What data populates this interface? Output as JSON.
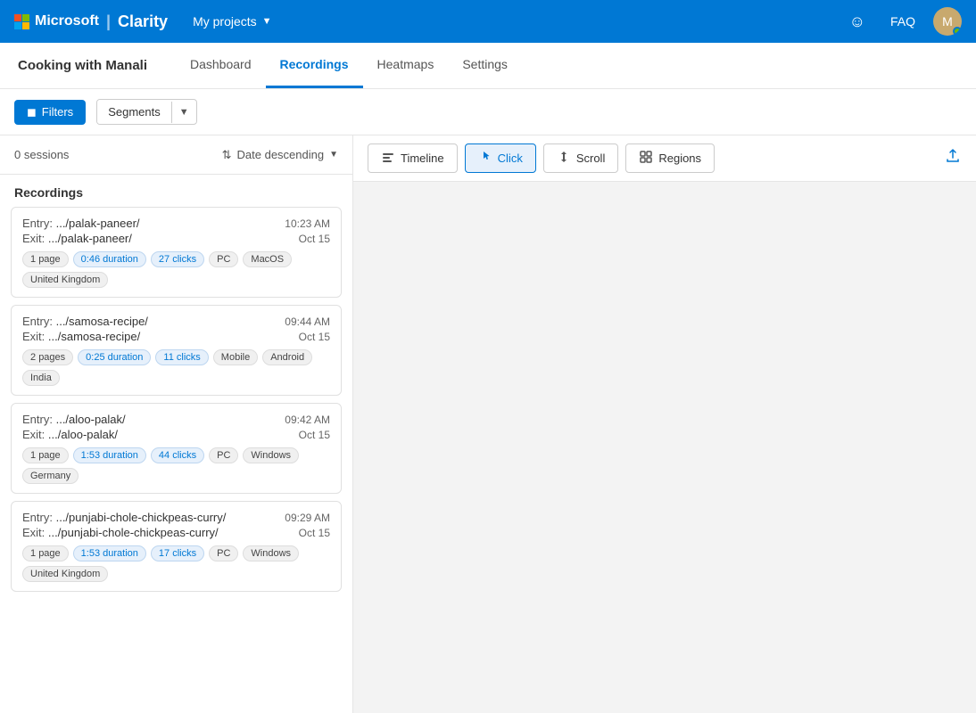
{
  "brand": {
    "ms_label": "Microsoft",
    "divider": "|",
    "clarity": "Clarity",
    "my_projects": "My projects"
  },
  "nav": {
    "faq": "FAQ",
    "avatar_initials": "M"
  },
  "sub_header": {
    "project_title": "Cooking with Manali",
    "tabs": [
      {
        "id": "dashboard",
        "label": "Dashboard",
        "active": false
      },
      {
        "id": "recordings",
        "label": "Recordings",
        "active": true
      },
      {
        "id": "heatmaps",
        "label": "Heatmaps",
        "active": false
      },
      {
        "id": "settings",
        "label": "Settings",
        "active": false
      }
    ]
  },
  "toolbar": {
    "filters_label": "Filters",
    "segments_label": "Segments"
  },
  "sessions": {
    "count_label": "0 sessions",
    "sort_label": "Date descending"
  },
  "recordings_section": {
    "title": "Recordings",
    "cards": [
      {
        "entry_label": "Entry:",
        "entry_path": ".../palak-paneer/",
        "exit_label": "Exit:",
        "exit_path": ".../palak-paneer/",
        "time": "10:23 AM",
        "date": "Oct 15",
        "pages": "1",
        "pages_label": "page",
        "duration": "0:46",
        "duration_label": "duration",
        "clicks": "27",
        "clicks_label": "clicks",
        "tags": [
          "PC",
          "MacOS",
          "United Kingdom"
        ]
      },
      {
        "entry_label": "Entry:",
        "entry_path": ".../samosa-recipe/",
        "exit_label": "Exit:",
        "exit_path": ".../samosa-recipe/",
        "time": "09:44 AM",
        "date": "Oct 15",
        "pages": "2",
        "pages_label": "pages",
        "duration": "0:25",
        "duration_label": "duration",
        "clicks": "11",
        "clicks_label": "clicks",
        "tags": [
          "Mobile",
          "Android",
          "India"
        ]
      },
      {
        "entry_label": "Entry:",
        "entry_path": ".../aloo-palak/",
        "exit_label": "Exit:",
        "exit_path": ".../aloo-palak/",
        "time": "09:42 AM",
        "date": "Oct 15",
        "pages": "1",
        "pages_label": "page",
        "duration": "1:53",
        "duration_label": "duration",
        "clicks": "44",
        "clicks_label": "clicks",
        "tags": [
          "PC",
          "Windows",
          "Germany"
        ]
      },
      {
        "entry_label": "Entry:",
        "entry_path": ".../punjabi-chole-chickpeas-curry/",
        "exit_label": "Exit:",
        "exit_path": ".../punjabi-chole-chickpeas-curry/",
        "time": "09:29 AM",
        "date": "Oct 15",
        "pages": "1",
        "pages_label": "page",
        "duration": "1:53",
        "duration_label": "duration",
        "clicks": "17",
        "clicks_label": "clicks",
        "tags": [
          "PC",
          "Windows",
          "United Kingdom"
        ]
      }
    ]
  },
  "playback": {
    "buttons": [
      {
        "id": "timeline",
        "label": "Timeline",
        "icon": "timeline-icon",
        "active": false
      },
      {
        "id": "click",
        "label": "Click",
        "icon": "click-icon",
        "active": true
      },
      {
        "id": "scroll",
        "label": "Scroll",
        "icon": "scroll-icon",
        "active": false
      },
      {
        "id": "regions",
        "label": "Regions",
        "icon": "regions-icon",
        "active": false
      }
    ],
    "export_icon": "export-icon"
  }
}
